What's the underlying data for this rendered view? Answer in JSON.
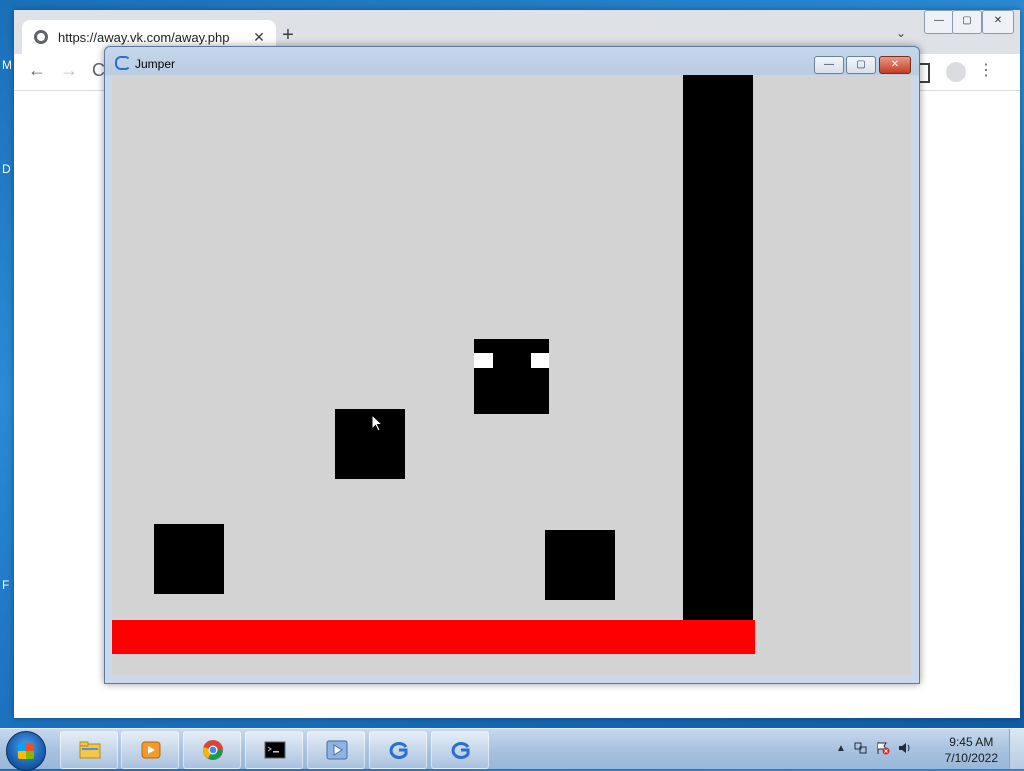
{
  "browser": {
    "tab_title": "https://away.vk.com/away.php",
    "tab_close": "✕",
    "new_tab": "+",
    "tab_menu": "⌄",
    "back": "←",
    "forward": "→",
    "reload": "C",
    "menu": "⋮"
  },
  "game_window": {
    "title": "Jumper",
    "minimize": "—",
    "maximize": "▢",
    "close": "✕"
  },
  "game": {
    "background": "#d3d3d3",
    "block_color": "#000000",
    "floor_color": "#ff0000",
    "eye_color": "#ffffff"
  },
  "desktop": {
    "glyph_1": "M",
    "glyph_2": "D",
    "glyph_3": "F"
  },
  "taskbar": {
    "time": "9:45 AM",
    "date": "7/10/2022",
    "tray_arrow": "▲",
    "items": [
      {
        "name": "explorer"
      },
      {
        "name": "media-player"
      },
      {
        "name": "chrome"
      },
      {
        "name": "terminal"
      },
      {
        "name": "media-player-2"
      },
      {
        "name": "godot-1"
      },
      {
        "name": "godot-2"
      }
    ]
  }
}
